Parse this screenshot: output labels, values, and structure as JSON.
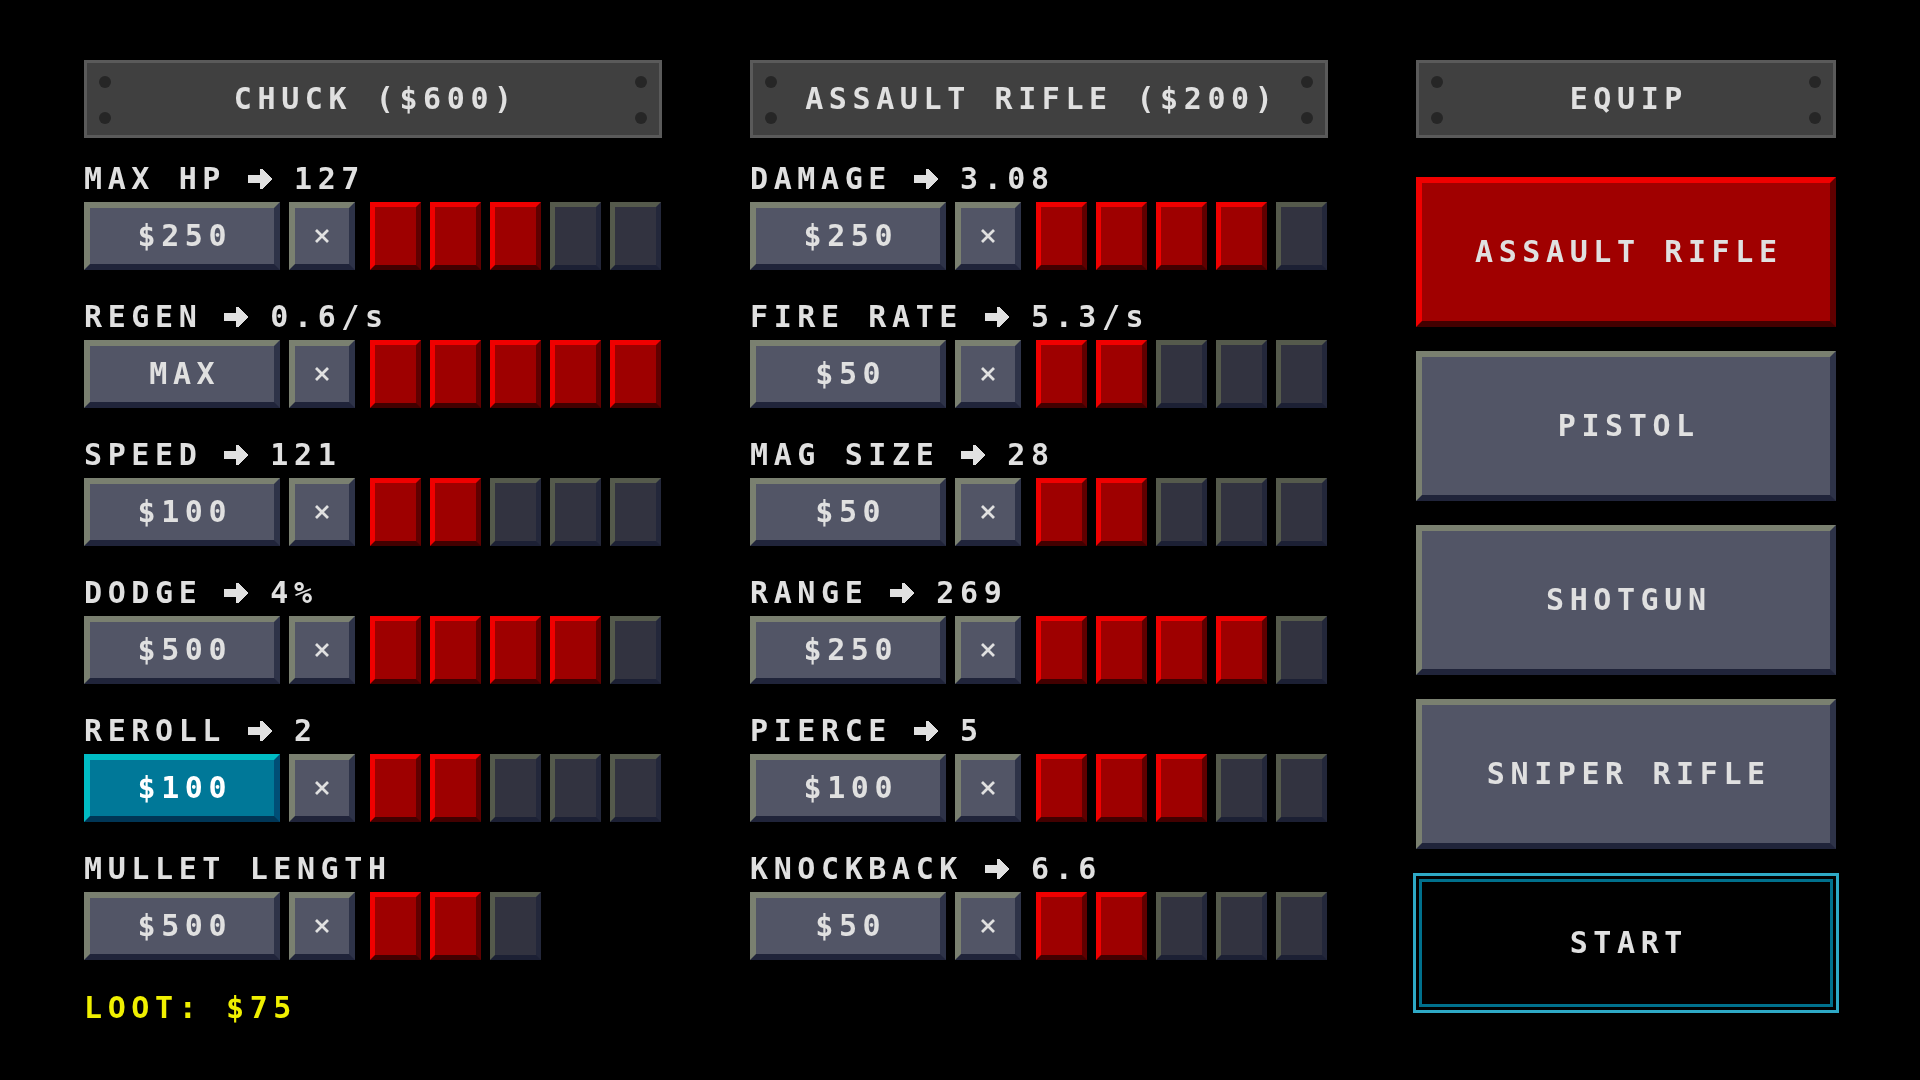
{
  "character_panel": {
    "title": "CHUCK ($600)",
    "stats": [
      {
        "name": "MAX HP",
        "value": "127",
        "price": "$250",
        "focused": false,
        "pips": [
          {
            "filled": true
          },
          {
            "filled": true
          },
          {
            "filled": true
          },
          {
            "filled": false
          },
          {
            "filled": false
          }
        ]
      },
      {
        "name": "REGEN",
        "value": "0.6/s",
        "price": "MAX",
        "focused": false,
        "pips": [
          {
            "filled": true
          },
          {
            "filled": true
          },
          {
            "filled": true
          },
          {
            "filled": true
          },
          {
            "filled": true
          }
        ]
      },
      {
        "name": "SPEED",
        "value": "121",
        "price": "$100",
        "focused": false,
        "pips": [
          {
            "filled": true
          },
          {
            "filled": true
          },
          {
            "filled": false
          },
          {
            "filled": false
          },
          {
            "filled": false
          }
        ]
      },
      {
        "name": "DODGE",
        "value": "4%",
        "price": "$500",
        "focused": false,
        "pips": [
          {
            "filled": true
          },
          {
            "filled": true
          },
          {
            "filled": true
          },
          {
            "filled": true
          },
          {
            "filled": false
          }
        ]
      },
      {
        "name": "REROLL",
        "value": "2",
        "price": "$100",
        "focused": true,
        "pips": [
          {
            "filled": true
          },
          {
            "filled": true
          },
          {
            "filled": false
          },
          {
            "filled": false
          },
          {
            "filled": false
          }
        ]
      },
      {
        "name": "MULLET LENGTH",
        "price": "$500",
        "focused": false,
        "pips": [
          {
            "filled": true
          },
          {
            "filled": true
          },
          {
            "filled": false
          }
        ]
      }
    ],
    "loot": "LOOT: $75"
  },
  "weapon_panel": {
    "title": "ASSAULT RIFLE ($200)",
    "stats": [
      {
        "name": "DAMAGE",
        "value": "3.08",
        "price": "$250",
        "focused": false,
        "pips": [
          {
            "filled": true
          },
          {
            "filled": true
          },
          {
            "filled": true
          },
          {
            "filled": true
          },
          {
            "filled": false
          }
        ]
      },
      {
        "name": "FIRE RATE",
        "value": "5.3/s",
        "price": "$50",
        "focused": false,
        "pips": [
          {
            "filled": true
          },
          {
            "filled": true
          },
          {
            "filled": false
          },
          {
            "filled": false
          },
          {
            "filled": false
          }
        ]
      },
      {
        "name": "MAG SIZE",
        "value": "28",
        "price": "$50",
        "focused": false,
        "pips": [
          {
            "filled": true
          },
          {
            "filled": true
          },
          {
            "filled": false
          },
          {
            "filled": false
          },
          {
            "filled": false
          }
        ]
      },
      {
        "name": "RANGE",
        "value": "269",
        "price": "$250",
        "focused": false,
        "pips": [
          {
            "filled": true
          },
          {
            "filled": true
          },
          {
            "filled": true
          },
          {
            "filled": true
          },
          {
            "filled": false
          }
        ]
      },
      {
        "name": "PIERCE",
        "value": "5",
        "price": "$100",
        "focused": false,
        "pips": [
          {
            "filled": true
          },
          {
            "filled": true
          },
          {
            "filled": true
          },
          {
            "filled": false
          },
          {
            "filled": false
          }
        ]
      },
      {
        "name": "KNOCKBACK",
        "value": "6.6",
        "price": "$50",
        "focused": false,
        "pips": [
          {
            "filled": true
          },
          {
            "filled": true
          },
          {
            "filled": false
          },
          {
            "filled": false
          },
          {
            "filled": false
          }
        ]
      }
    ]
  },
  "equip_panel": {
    "title": "EQUIP",
    "weapons": [
      {
        "label": "ASSAULT RIFLE",
        "selected": true
      },
      {
        "label": "PISTOL",
        "selected": false
      },
      {
        "label": "SHOTGUN",
        "selected": false
      },
      {
        "label": "SNIPER RIFLE",
        "selected": false
      }
    ],
    "start_button": "START"
  }
}
